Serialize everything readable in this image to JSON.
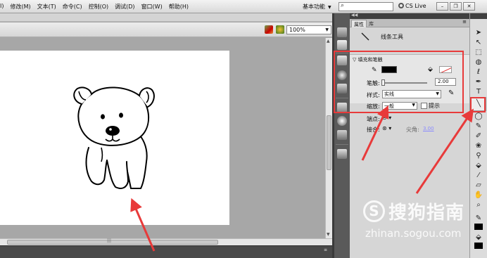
{
  "menu": [
    "I)",
    "修改(M)",
    "文本(T)",
    "命令(C)",
    "控制(O)",
    "调试(D)",
    "窗口(W)",
    "帮助(H)"
  ],
  "workspace_label": "基本功能",
  "cs_live": "CS Live",
  "zoom": "100%",
  "panel": {
    "tab_properties": "属性",
    "tab_library": "库",
    "tool_name": "线条工具",
    "section_title": "填充和笔触",
    "stroke_label": "笔触:",
    "stroke_value": "2.00",
    "style_label": "样式:",
    "style_value": "实线",
    "scale_label": "缩放:",
    "scale_value": "一般",
    "hint_label": "提示",
    "cap_label": "端点:",
    "join_label": "接合:",
    "miter_label": "尖角:",
    "miter_value": "3.00"
  },
  "colors": {
    "stroke": "#000000",
    "annotation": "#e83a3a"
  },
  "watermark": {
    "logo": "S",
    "text": "搜狗指南",
    "url": "zhinan.sogou.com"
  }
}
